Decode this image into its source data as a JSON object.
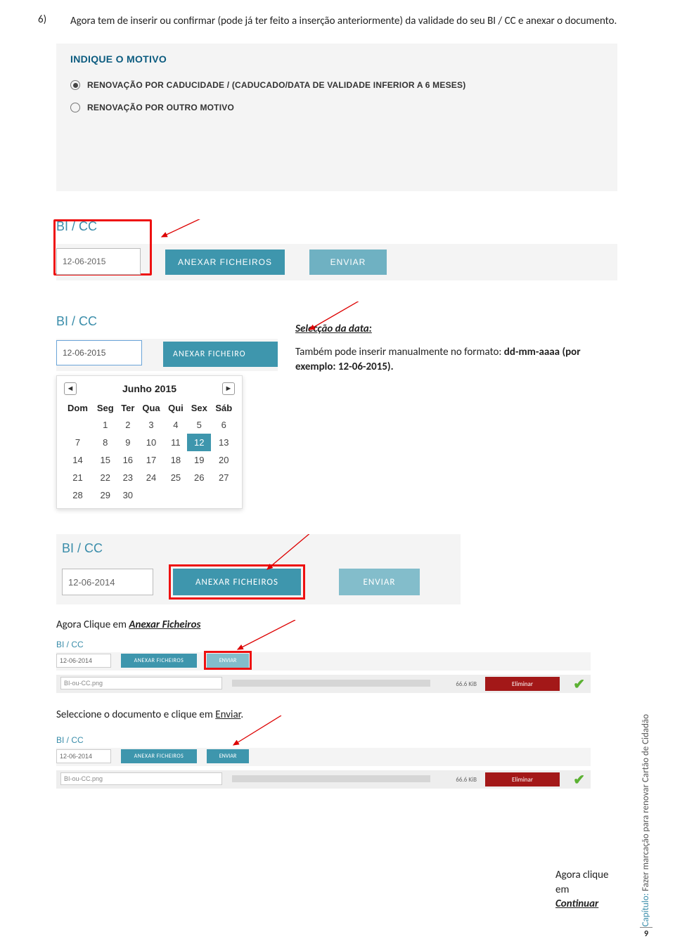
{
  "step_number": "6)",
  "intro_text": "Agora tem de inserir ou confirmar (pode já ter feito a inserção anteriormente) da validade do seu BI / CC e anexar o documento.",
  "shot1": {
    "title": "INDIQUE O MOTIVO",
    "opt1": "RENOVAÇÃO POR CADUCIDADE / (CADUCADO/DATA DE VALIDADE INFERIOR A 6 MESES)",
    "opt2": "RENOVAÇÃO POR OUTRO MOTIVO"
  },
  "bi_label": "BI / CC",
  "anexar_label": "ANEXAR FICHEIROS",
  "anexar_label_cut": "ANEXAR FICHEIRO",
  "enviar_label": "ENVIAR",
  "date1": "12-06-2015",
  "date2": "12-06-2015",
  "date3": "12-06-2014",
  "date4": "12-06-2014",
  "cal": {
    "month": "Junho 2015",
    "dows": [
      "Dom",
      "Seg",
      "Ter",
      "Qua",
      "Qui",
      "Sex",
      "Sáb"
    ],
    "weeks": [
      [
        "",
        "1",
        "2",
        "3",
        "4",
        "5",
        "6"
      ],
      [
        "7",
        "8",
        "9",
        "10",
        "11",
        "12",
        "13"
      ],
      [
        "14",
        "15",
        "16",
        "17",
        "18",
        "19",
        "20"
      ],
      [
        "21",
        "22",
        "23",
        "24",
        "25",
        "26",
        "27"
      ],
      [
        "28",
        "29",
        "30",
        "",
        "",
        "",
        ""
      ]
    ],
    "selected": "12"
  },
  "selec_hdr": "Selecção da data:",
  "selec_body_a": "Também pode inserir manualmente no formato: ",
  "selec_body_b": "dd-mm-aaaa (por exemplo: 12-06-2015).",
  "sub1_a": "Agora Clique em ",
  "sub1_b": "Anexar Ficheiros",
  "filename": "BI-ou-CC.png",
  "filesize": "66.6 KiB",
  "eliminar": "Eliminar",
  "sub2_a": "Seleccione o documento e clique em ",
  "sub2_b": "Enviar",
  "sub2_c": ".",
  "agora_a": "Agora clique em ",
  "agora_b": "Continuar",
  "side_cap": "Capítulo:",
  "side_rest": " Fazer marcação para renovar Cartão de Cidadão",
  "pagenum": "9"
}
